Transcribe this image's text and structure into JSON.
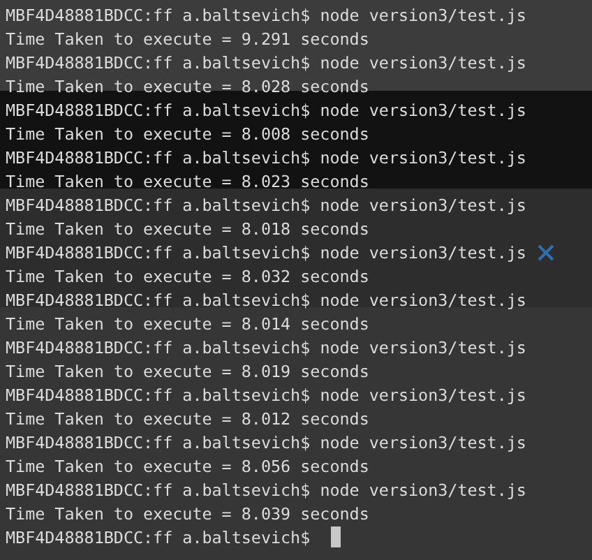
{
  "terminal": {
    "lines": [
      {
        "kind": "prompt",
        "prompt": "MBF4D48881BDCC:ff a.baltsevich$",
        "command": "node version3/test.js"
      },
      {
        "kind": "output",
        "text": "Time Taken to execute = 9.291 seconds"
      },
      {
        "kind": "prompt",
        "prompt": "MBF4D48881BDCC:ff a.baltsevich$",
        "command": "node version3/test.js"
      },
      {
        "kind": "output",
        "text": "Time Taken to execute = 8.028 seconds"
      },
      {
        "kind": "prompt",
        "prompt": "MBF4D48881BDCC:ff a.baltsevich$",
        "command": "node version3/test.js"
      },
      {
        "kind": "output",
        "text": "Time Taken to execute = 8.008 seconds"
      },
      {
        "kind": "prompt",
        "prompt": "MBF4D48881BDCC:ff a.baltsevich$",
        "command": "node version3/test.js"
      },
      {
        "kind": "output",
        "text": "Time Taken to execute = 8.023 seconds"
      },
      {
        "kind": "prompt",
        "prompt": "MBF4D48881BDCC:ff a.baltsevich$",
        "command": "node version3/test.js"
      },
      {
        "kind": "output",
        "text": "Time Taken to execute = 8.018 seconds"
      },
      {
        "kind": "prompt",
        "prompt": "MBF4D48881BDCC:ff a.baltsevich$",
        "command": "node version3/test.js"
      },
      {
        "kind": "output",
        "text": "Time Taken to execute = 8.032 seconds"
      },
      {
        "kind": "prompt",
        "prompt": "MBF4D48881BDCC:ff a.baltsevich$",
        "command": "node version3/test.js"
      },
      {
        "kind": "output",
        "text": "Time Taken to execute = 8.014 seconds"
      },
      {
        "kind": "prompt",
        "prompt": "MBF4D48881BDCC:ff a.baltsevich$",
        "command": "node version3/test.js"
      },
      {
        "kind": "output",
        "text": "Time Taken to execute = 8.019 seconds"
      },
      {
        "kind": "prompt",
        "prompt": "MBF4D48881BDCC:ff a.baltsevich$",
        "command": "node version3/test.js"
      },
      {
        "kind": "output",
        "text": "Time Taken to execute = 8.012 seconds"
      },
      {
        "kind": "prompt",
        "prompt": "MBF4D48881BDCC:ff a.baltsevich$",
        "command": "node version3/test.js"
      },
      {
        "kind": "output",
        "text": "Time Taken to execute = 8.056 seconds"
      },
      {
        "kind": "prompt",
        "prompt": "MBF4D48881BDCC:ff a.baltsevich$",
        "command": "node version3/test.js"
      },
      {
        "kind": "output",
        "text": "Time Taken to execute = 8.039 seconds"
      },
      {
        "kind": "prompt",
        "prompt": "MBF4D48881BDCC:ff a.baltsevich$",
        "cursor": true
      }
    ]
  }
}
